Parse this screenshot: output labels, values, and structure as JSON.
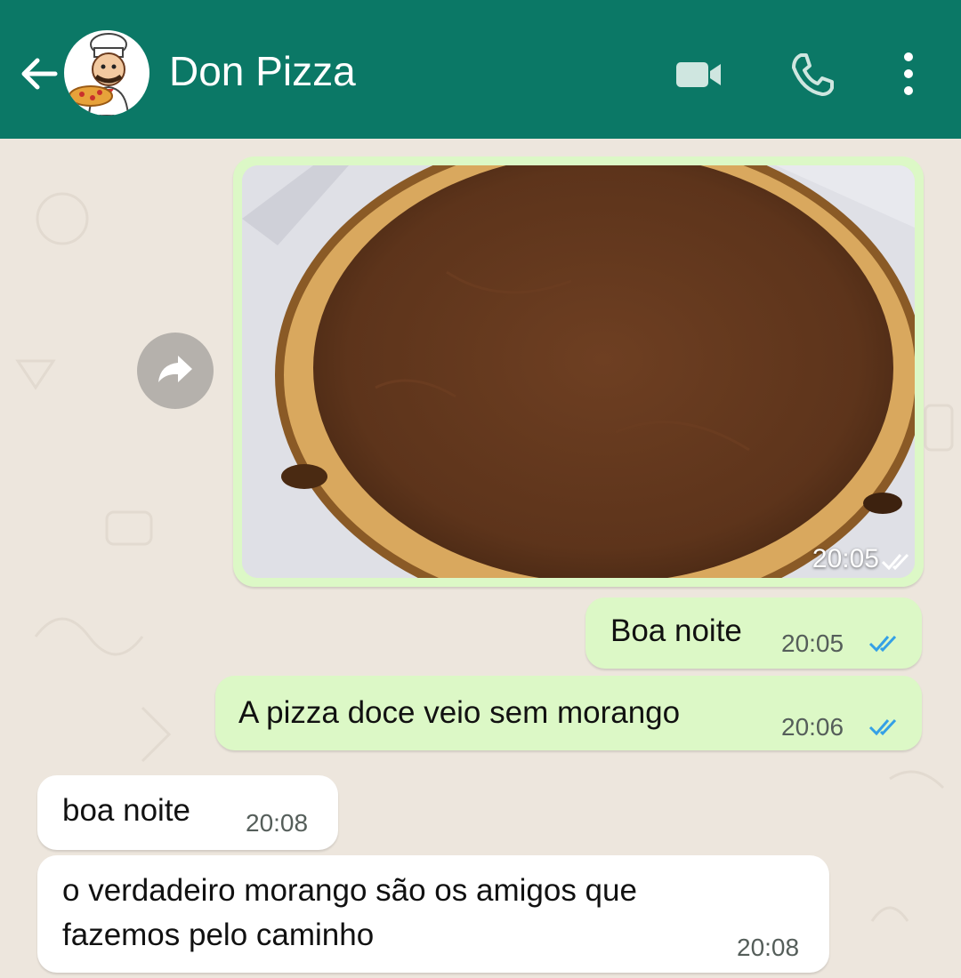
{
  "header": {
    "title": "Don Pizza",
    "background": "#0b7866",
    "icons": [
      "back-arrow-icon",
      "video-camera-icon",
      "phone-icon",
      "more-vert-icon"
    ]
  },
  "messages": [
    {
      "type": "image",
      "direction": "outgoing",
      "time": "20:05",
      "status": "read",
      "image_alt": "chocolate pizza"
    },
    {
      "type": "text",
      "direction": "outgoing",
      "text": "Boa noite",
      "time": "20:05",
      "status": "read"
    },
    {
      "type": "text",
      "direction": "outgoing",
      "text": "A pizza doce veio sem morango",
      "time": "20:06",
      "status": "read"
    },
    {
      "type": "text",
      "direction": "incoming",
      "text": "boa noite",
      "time": "20:08"
    },
    {
      "type": "text",
      "direction": "incoming",
      "line1": "o verdadeiro morango são os amigos que",
      "line2": "fazemos pelo caminho",
      "time": "20:08"
    }
  ],
  "colors": {
    "outgoing_bubble": "#dcf8c6",
    "incoming_bubble": "#ffffff",
    "chat_background": "#ede6dd",
    "read_ticks": "#34a0e6"
  }
}
